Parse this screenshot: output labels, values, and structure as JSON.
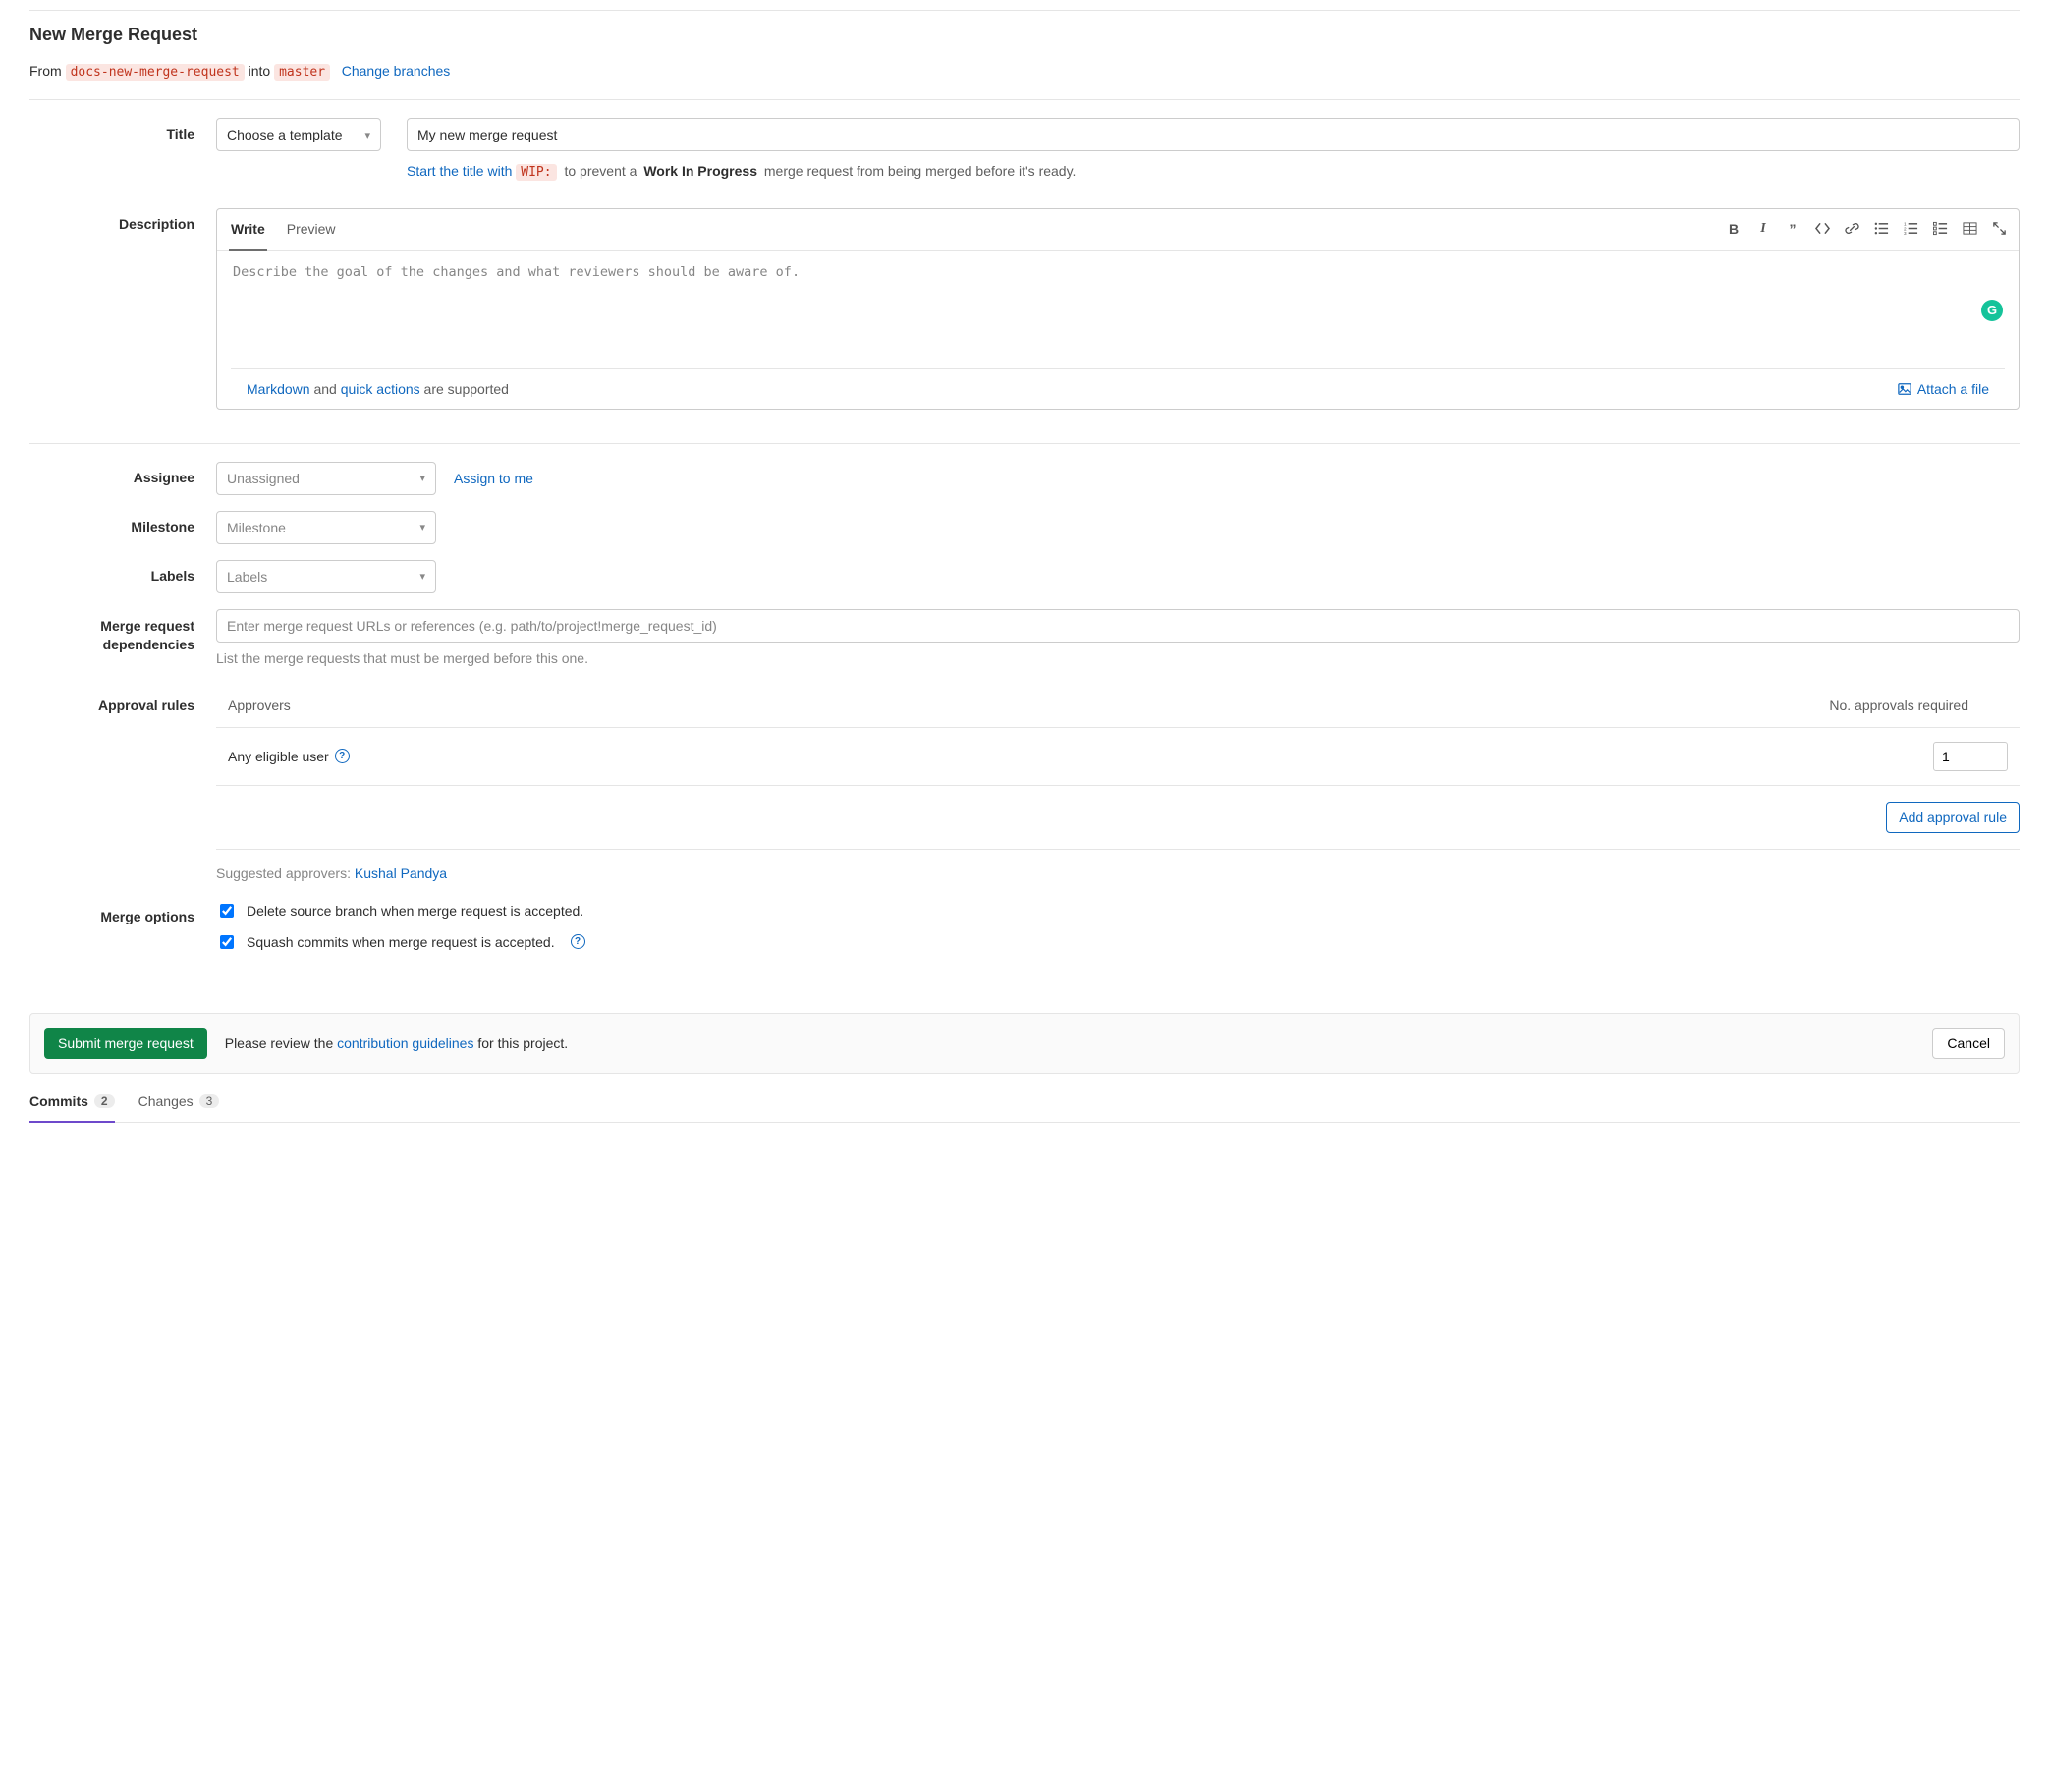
{
  "page_title": "New Merge Request",
  "branch_line": {
    "from_label": "From",
    "source_branch": "docs-new-merge-request",
    "into_label": "into",
    "target_branch": "master",
    "change_link": "Change branches"
  },
  "title": {
    "label": "Title",
    "template_placeholder": "Choose a template",
    "value": "My new merge request",
    "hint_prefix": "Start the title with",
    "hint_code": "WIP:",
    "hint_mid": "to prevent a",
    "hint_bold": "Work In Progress",
    "hint_suffix": "merge request from being merged before it's ready."
  },
  "description": {
    "label": "Description",
    "tab_write": "Write",
    "tab_preview": "Preview",
    "placeholder": "Describe the goal of the changes and what reviewers should be aware of.",
    "footer_markdown": "Markdown",
    "footer_and": " and ",
    "footer_quick": "quick actions",
    "footer_suffix": " are supported",
    "attach_label": "Attach a file"
  },
  "assignee": {
    "label": "Assignee",
    "placeholder": "Unassigned",
    "assign_me": "Assign to me"
  },
  "milestone": {
    "label": "Milestone",
    "placeholder": "Milestone"
  },
  "labels": {
    "label": "Labels",
    "placeholder": "Labels"
  },
  "deps": {
    "label_l1": "Merge request",
    "label_l2": "dependencies",
    "placeholder": "Enter merge request URLs or references (e.g. path/to/project!merge_request_id)",
    "help": "List the merge requests that must be merged before this one."
  },
  "approvals": {
    "label": "Approval rules",
    "col_approvers": "Approvers",
    "col_required": "No. approvals required",
    "row_label": "Any eligible user",
    "row_value": "1",
    "add_rule": "Add approval rule",
    "suggested_prefix": "Suggested approvers: ",
    "suggested_name": "Kushal Pandya"
  },
  "merge_options": {
    "label": "Merge options",
    "delete_branch": "Delete source branch when merge request is accepted.",
    "squash": "Squash commits when merge request is accepted."
  },
  "submit": {
    "button": "Submit merge request",
    "review_prefix": "Please review the ",
    "guidelines": "contribution guidelines",
    "review_suffix": " for this project.",
    "cancel": "Cancel"
  },
  "bottom_tabs": {
    "commits_label": "Commits",
    "commits_count": "2",
    "changes_label": "Changes",
    "changes_count": "3"
  }
}
